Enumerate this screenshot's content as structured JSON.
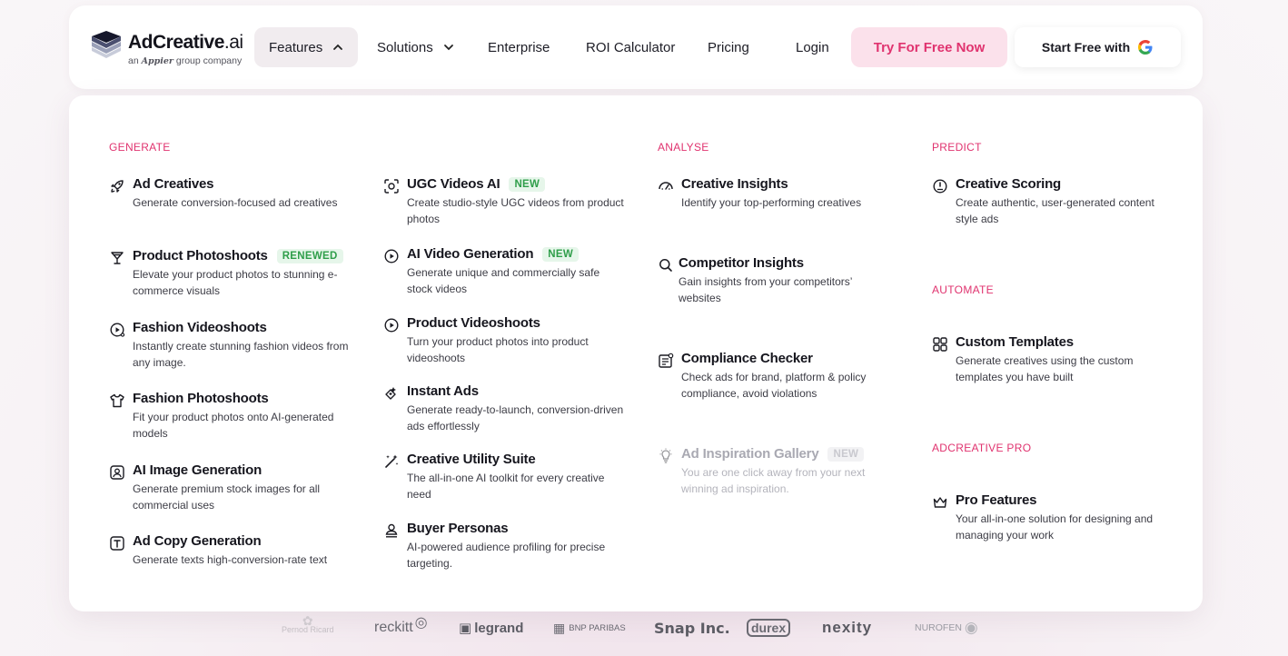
{
  "header": {
    "logo": {
      "name": "AdCreative",
      "suffix": ".ai",
      "tagline_prefix": "an",
      "tagline_brand": "Appier",
      "tagline_suffix": "group company"
    },
    "nav": {
      "features": "Features",
      "solutions": "Solutions",
      "enterprise": "Enterprise",
      "roi": "ROI Calculator",
      "pricing": "Pricing",
      "login": "Login"
    },
    "try_button": "Try For Free Now",
    "google_button": "Start Free with",
    "google_icon": "google-g-icon"
  },
  "colors": {
    "accent": "#e0336f",
    "badge_green": "#2f9e4a",
    "badge_green_bg": "#e6f6ea",
    "try_bg": "#fbe1eb"
  },
  "menu": {
    "generate": {
      "heading": "GENERATE",
      "col1": [
        {
          "icon": "rocket-icon",
          "title": "Ad Creatives",
          "desc": "Generate conversion-focused ad creatives"
        },
        {
          "icon": "cocktail-glass-icon",
          "title": "Product Photoshoots",
          "badge": "RENEWED",
          "desc": "Elevate your product photos to stunning e-commerce visuals"
        },
        {
          "icon": "video-play-icon",
          "title": "Fashion Videoshoots",
          "desc": "Instantly create stunning fashion videos from any image."
        },
        {
          "icon": "tshirt-icon",
          "title": "Fashion Photoshoots",
          "desc": "Fit your product photos onto AI-generated models"
        },
        {
          "icon": "image-person-icon",
          "title": "AI Image Generation",
          "desc": "Generate premium stock images for all commercial uses"
        },
        {
          "icon": "text-box-icon",
          "title": "Ad Copy Generation",
          "desc": "Generate texts high-conversion-rate text"
        }
      ],
      "col2": [
        {
          "icon": "focus-scan-icon",
          "title": "UGC Videos AI",
          "badge": "NEW",
          "desc": "Create studio-style UGC videos from product photos"
        },
        {
          "icon": "play-circle-icon",
          "title": "AI Video Generation",
          "badge": "NEW",
          "desc": "Generate unique and commercially safe stock videos"
        },
        {
          "icon": "play-circle-icon",
          "title": "Product Videoshoots",
          "desc": "Turn your product photos into product videoshoots"
        },
        {
          "icon": "instant-spark-icon",
          "title": "Instant Ads",
          "desc": "Generate ready-to-launch, conversion-driven ads effortlessly"
        },
        {
          "icon": "magic-wand-icon",
          "title": "Creative Utility Suite",
          "desc": "The all-in-one AI toolkit for every creative need"
        },
        {
          "icon": "persona-icon",
          "title": "Buyer Personas",
          "desc": "AI-powered audience profiling for precise targeting."
        }
      ]
    },
    "analyse": {
      "heading": "ANALYSE",
      "items": [
        {
          "icon": "gauge-icon",
          "title": "Creative Insights",
          "desc": "Identify your top-performing creatives"
        },
        {
          "icon": "search-icon",
          "title": "Competitor Insights",
          "desc": "Gain insights from your competitors’ websites"
        },
        {
          "icon": "checklist-icon",
          "title": "Compliance Checker",
          "desc": "Check ads for brand, platform & policy compliance, avoid violations"
        },
        {
          "icon": "lightbulb-icon",
          "title": "Ad Inspiration Gallery",
          "badge": "NEW",
          "desc": "You are one click away from your next winning ad inspiration."
        }
      ]
    },
    "predict": {
      "heading": "PREDICT",
      "items": [
        {
          "icon": "score-dial-icon",
          "title": "Creative Scoring",
          "desc": "Create authentic, user-generated content style ads"
        }
      ]
    },
    "automate": {
      "heading": "AUTOMATE",
      "items": [
        {
          "icon": "templates-grid-icon",
          "title": "Custom Templates",
          "desc": "Generate creatives using the custom templates you have built"
        }
      ]
    },
    "pro": {
      "heading": "ADCREATIVE PRO",
      "items": [
        {
          "icon": "crown-icon",
          "title": "Pro Features",
          "desc": "Your all-in-one solution for designing and managing your work"
        }
      ]
    }
  },
  "brands": [
    "Pernod Ricard",
    "reckitt",
    "legrand",
    "BNP PARIBAS",
    "Snap Inc.",
    "durex",
    "nexity",
    "NUROFEN"
  ]
}
